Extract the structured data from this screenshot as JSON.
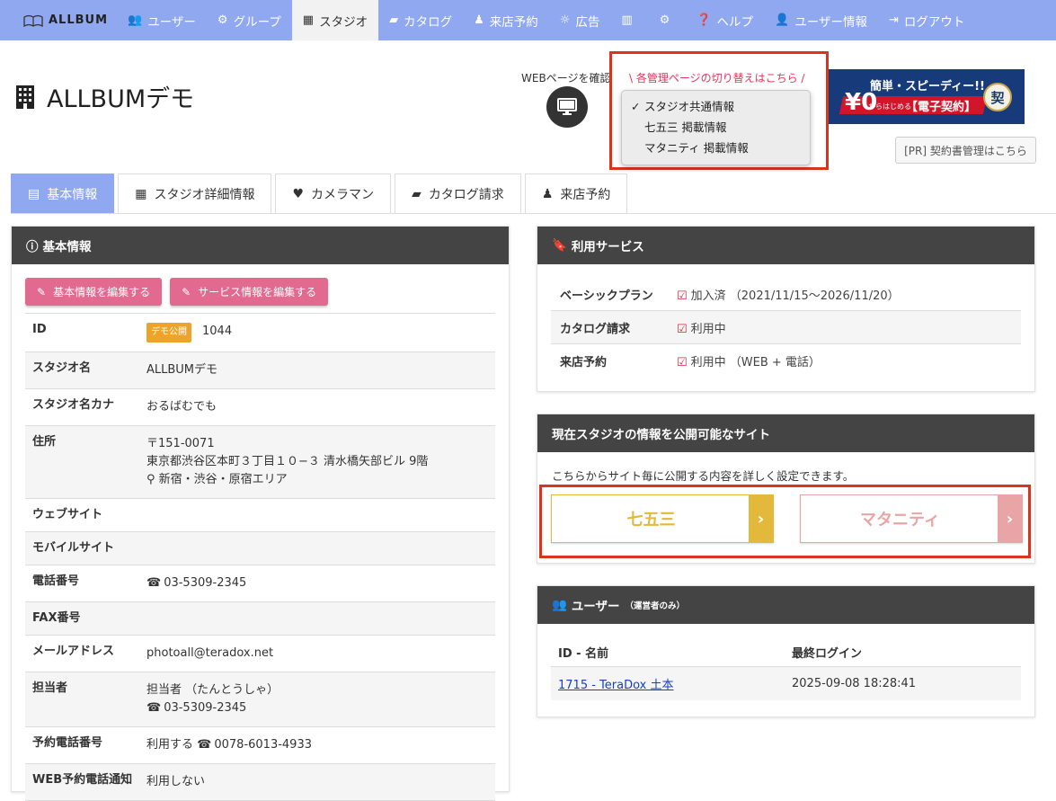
{
  "nav": {
    "brand": "ALLBUM",
    "items": [
      {
        "label": "ユーザー",
        "icon": "users-icon"
      },
      {
        "label": "グループ",
        "icon": "cogs-icon"
      },
      {
        "label": "スタジオ",
        "icon": "building-icon",
        "active": true
      },
      {
        "label": "カタログ",
        "icon": "book-icon"
      },
      {
        "label": "来店予約",
        "icon": "person-icon"
      },
      {
        "label": "広告",
        "icon": "lightbulb-icon"
      },
      {
        "label": "",
        "icon": "bar-chart-icon"
      },
      {
        "label": "",
        "icon": "gears-icon"
      },
      {
        "label": "ヘルプ",
        "icon": "question-icon"
      },
      {
        "label": "ユーザー情報",
        "icon": "user-icon"
      },
      {
        "label": "ログアウト",
        "icon": "logout-icon"
      }
    ]
  },
  "header": {
    "title": "ALLBUMデモ",
    "webcheck": "WEBページを確認",
    "switch_label": "\\ 各管理ページの切り替えはこちら /",
    "switch_options": [
      "スタジオ共通情報",
      "七五三 掲載情報",
      "マタニティ 掲載情報"
    ],
    "banner": {
      "line1": "簡単・スピーディー!!",
      "zero": "¥0",
      "small": "からはじめる",
      "line2": "【電子契約】",
      "seal": "契"
    },
    "pr_button": "[PR] 契約書管理はこちら"
  },
  "tabs": [
    {
      "label": "基本情報",
      "active": true
    },
    {
      "label": "スタジオ詳細情報"
    },
    {
      "label": "カメラマン"
    },
    {
      "label": "カタログ請求"
    },
    {
      "label": "来店予約"
    }
  ],
  "basic": {
    "title": "基本情報",
    "btn_edit_basic": "基本情報を編集する",
    "btn_edit_service": "サービス情報を編集する",
    "id_label": "ID",
    "id_badge": "デモ公開",
    "id_value": "1044",
    "name_label": "スタジオ名",
    "name_value": "ALLBUMデモ",
    "kana_label": "スタジオ名カナ",
    "kana_value": "おるばむでも",
    "addr_label": "住所",
    "addr_zip": "〒151-0071",
    "addr_line": "東京都渋谷区本町３丁目１０−３ 清水橋矢部ビル 9階",
    "addr_area": "新宿・渋谷・原宿エリア",
    "web_label": "ウェブサイト",
    "mobile_label": "モバイルサイト",
    "tel_label": "電話番号",
    "tel_value": "03-5309-2345",
    "fax_label": "FAX番号",
    "mail_label": "メールアドレス",
    "mail_value": "photoall@teradox.net",
    "person_label": "担当者",
    "person_name": "担当者 （たんとうしゃ）",
    "person_tel": "03-5309-2345",
    "rsv_label": "予約電話番号",
    "rsv_use": "利用する",
    "rsv_tel": "0078-6013-4933",
    "webrsv_label": "WEB予約電話通知",
    "webrsv_value": "利用しない"
  },
  "services": {
    "title": "利用サービス",
    "rows": [
      {
        "label": "ベーシックプラン",
        "value": "加入済 （2021/11/15〜2026/11/20）"
      },
      {
        "label": "カタログ請求",
        "value": "利用中"
      },
      {
        "label": "来店予約",
        "value": "利用中 （WEB + 電話）"
      }
    ]
  },
  "sites": {
    "title": "現在スタジオの情報を公開可能なサイト",
    "desc": "こちらからサイト毎に公開する内容を詳しく設定できます。",
    "shichigosan": "七五三",
    "maternity": "マタニティ",
    "colors": {
      "shichigosan": "#e2b93b",
      "maternity": "#e9a5a5"
    }
  },
  "users": {
    "title": "ユーザー",
    "note": "（運営者のみ）",
    "col_id": "ID - 名前",
    "col_login": "最終ログイン",
    "row_id": "1715 - TeraDox 土本",
    "row_login": "2025-09-08 18:28:41"
  }
}
